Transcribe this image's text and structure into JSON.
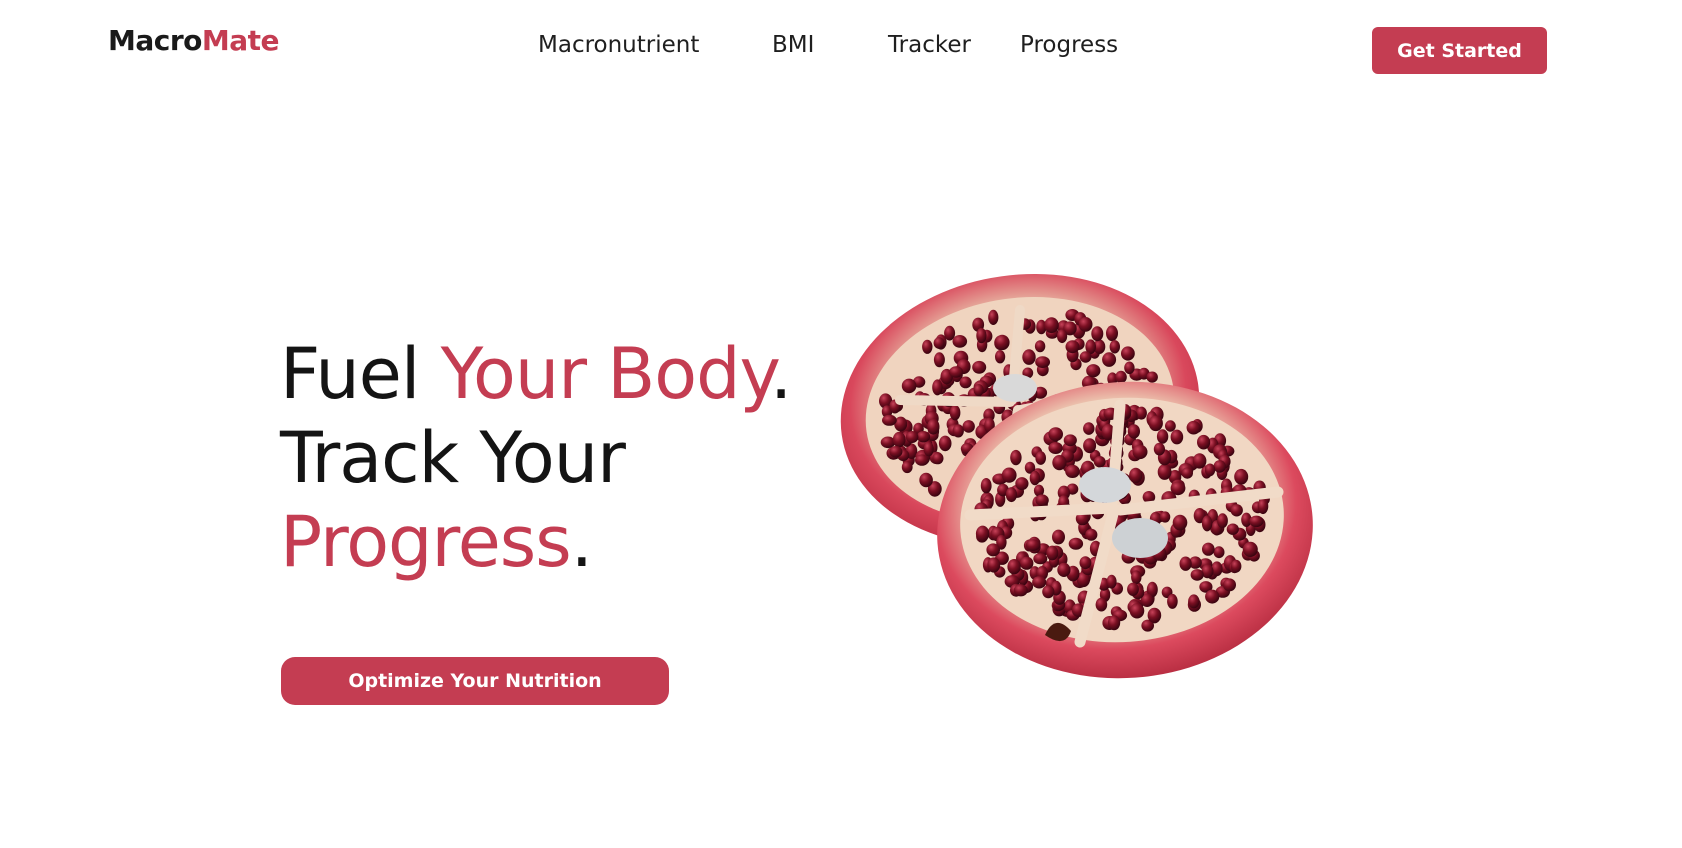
{
  "brand": {
    "name_part1": "Macro",
    "name_part2": "Mate"
  },
  "nav": {
    "items": [
      "Macronutrient",
      "BMI",
      "Tracker",
      "Progress"
    ]
  },
  "header": {
    "cta_label": "Get Started"
  },
  "hero": {
    "line1_plain": "Fuel ",
    "line1_accent": "Your Body",
    "line1_end": ".",
    "line2_plain": "Track Your",
    "line3_accent": "Progress",
    "line3_end": ".",
    "cta_label": "Optimize Your Nutrition",
    "image_subject": "pomegranate-halves"
  },
  "colors": {
    "accent": "#c43d52",
    "text": "#141414",
    "background": "#ffffff"
  }
}
